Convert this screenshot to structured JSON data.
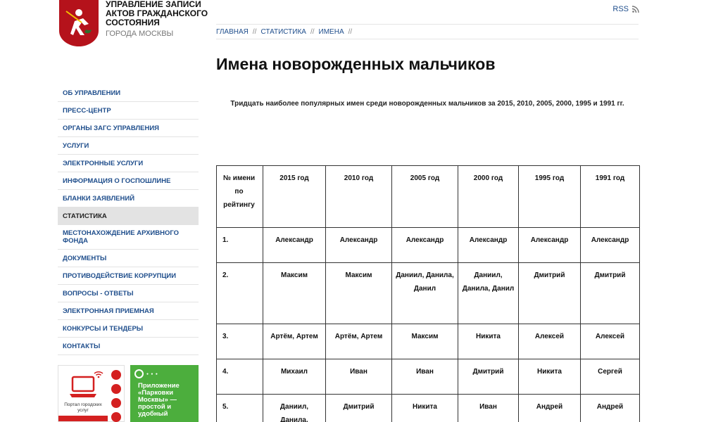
{
  "header": {
    "logo_line1": "Управление записи актов гражданского состояния",
    "logo_line2": "города Москвы",
    "rss_label": "RSS"
  },
  "breadcrumb": [
    "Главная",
    "Статистика",
    "Имена"
  ],
  "page_title": "Имена новорожденных мальчиков",
  "sidebar": {
    "items": [
      {
        "label": "Об управлении"
      },
      {
        "label": "Пресс-центр"
      },
      {
        "label": "Органы ЗАГС управления"
      },
      {
        "label": "Услуги"
      },
      {
        "label": "Электронные услуги"
      },
      {
        "label": "Информация о госпошлине"
      },
      {
        "label": "Бланки заявлений"
      },
      {
        "label": "Статистика",
        "active": true
      },
      {
        "label": "Местонахождение архивного фонда"
      },
      {
        "label": "Документы"
      },
      {
        "label": "Противодействие коррупции"
      },
      {
        "label": "Вопросы - ответы"
      },
      {
        "label": "Электронная приемная"
      },
      {
        "label": "Конкурсы и тендеры"
      },
      {
        "label": "Контакты"
      }
    ]
  },
  "banners": {
    "portal_caption": "Портал городских услуг",
    "parking_text": "Приложение «Парковки Москвы» — простой и удобный"
  },
  "intro_text": "Тридцать наиболее популярных имен среди новорожденных мальчиков за 2015, 2010, 2005, 2000, 1995 и 1991 гг.",
  "table": {
    "headers": [
      "№ имени по рейтингу",
      "2015 год",
      "2010 год",
      "2005 год",
      "2000 год",
      "1995 год",
      "1991 год"
    ],
    "rows": [
      [
        "1.",
        "Александр",
        "Александр",
        "Александр",
        "Александр",
        "Александр",
        "Александр"
      ],
      [
        "2.",
        "Максим",
        "Максим",
        "Даниил, Данила, Данил",
        "Даниил, Данила, Данил",
        "Дмитрий",
        "Дмитрий"
      ],
      [
        "3.",
        "Артём, Артем",
        "Артём, Артем",
        "Максим",
        "Никита",
        "Алексей",
        "Алексей"
      ],
      [
        "4.",
        "Михаил",
        "Иван",
        "Иван",
        "Дмитрий",
        "Никита",
        "Сергей"
      ],
      [
        "5.",
        "Даниил, Данила,",
        "Дмитрий",
        "Никита",
        "Иван",
        "Андрей",
        "Андрей"
      ]
    ]
  },
  "colors": {
    "link": "#1f4e8c",
    "crest": "#b5121b",
    "parking_green": "#4cae3d",
    "portal_red": "#d42020"
  }
}
